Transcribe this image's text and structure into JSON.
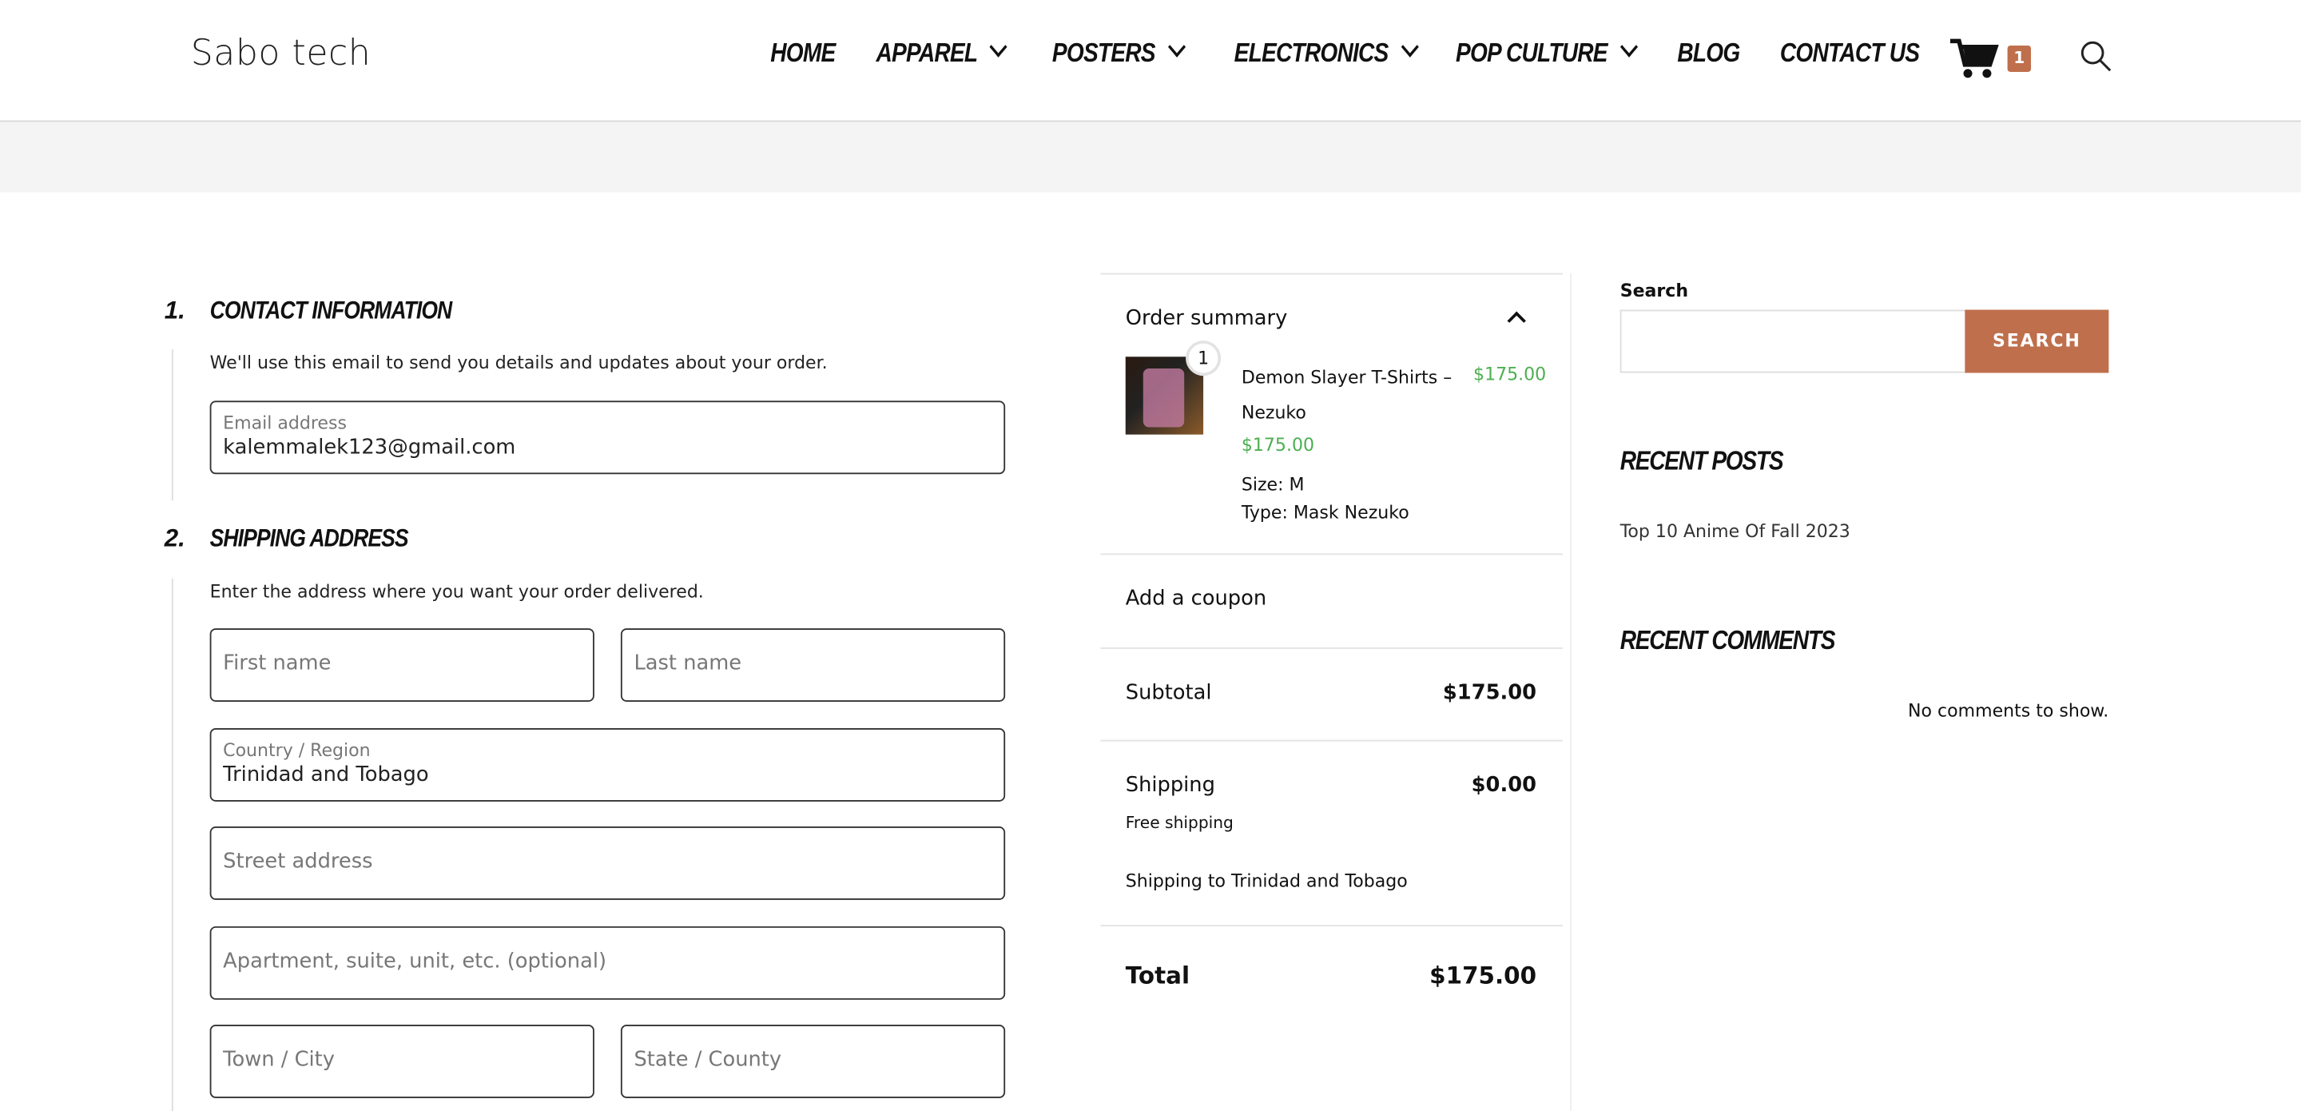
{
  "header": {
    "logo": "Sabo tech",
    "nav": [
      {
        "label": "HOME",
        "dropdown": false
      },
      {
        "label": "APPAREL",
        "dropdown": true
      },
      {
        "label": "POSTERS",
        "dropdown": true
      },
      {
        "label": "ELECTRONICS",
        "dropdown": true
      },
      {
        "label": "POP CULTURE",
        "dropdown": true
      },
      {
        "label": "BLOG",
        "dropdown": false
      },
      {
        "label": "CONTACT US",
        "dropdown": false
      }
    ],
    "cart_count": "1",
    "cart_badge_color": "#bf6f4c"
  },
  "contact": {
    "num": "1.",
    "title": "Contact information",
    "desc": "We'll use this email to send you details and updates about your order.",
    "email_label": "Email address",
    "email_value": "kalemmalek123@gmail.com"
  },
  "shipping": {
    "num": "2.",
    "title": "Shipping address",
    "desc": "Enter the address where you want your order delivered.",
    "first_name": "First name",
    "last_name": "Last name",
    "country_label": "Country / Region",
    "country_value": "Trinidad and Tobago",
    "street": "Street address",
    "apartment": "Apartment, suite, unit, etc. (optional)",
    "city": "Town / City",
    "state": "State / County"
  },
  "summary": {
    "title": "Order summary",
    "item": {
      "qty": "1",
      "name": "Demon Slayer T-Shirts – Nezuko",
      "line_price": "$175.00",
      "unit_price": "$175.00",
      "size": "Size: M",
      "type": "Type: Mask Nezuko"
    },
    "coupon": "Add a coupon",
    "subtotal_label": "Subtotal",
    "subtotal": "$175.00",
    "shipping_label": "Shipping",
    "shipping": "$0.00",
    "shipping_method": "Free shipping",
    "shipping_to": "Shipping to Trinidad and Tobago",
    "total_label": "Total",
    "total": "$175.00",
    "price_color": "#4caf50"
  },
  "sidebar": {
    "search_label": "Search",
    "search_value": "",
    "search_button": "SEARCH",
    "recent_posts_title": "Recent Posts",
    "posts": [
      "Top 10 Anime Of Fall 2023"
    ],
    "recent_comments_title": "Recent Comments",
    "no_comments": "No comments to show."
  }
}
